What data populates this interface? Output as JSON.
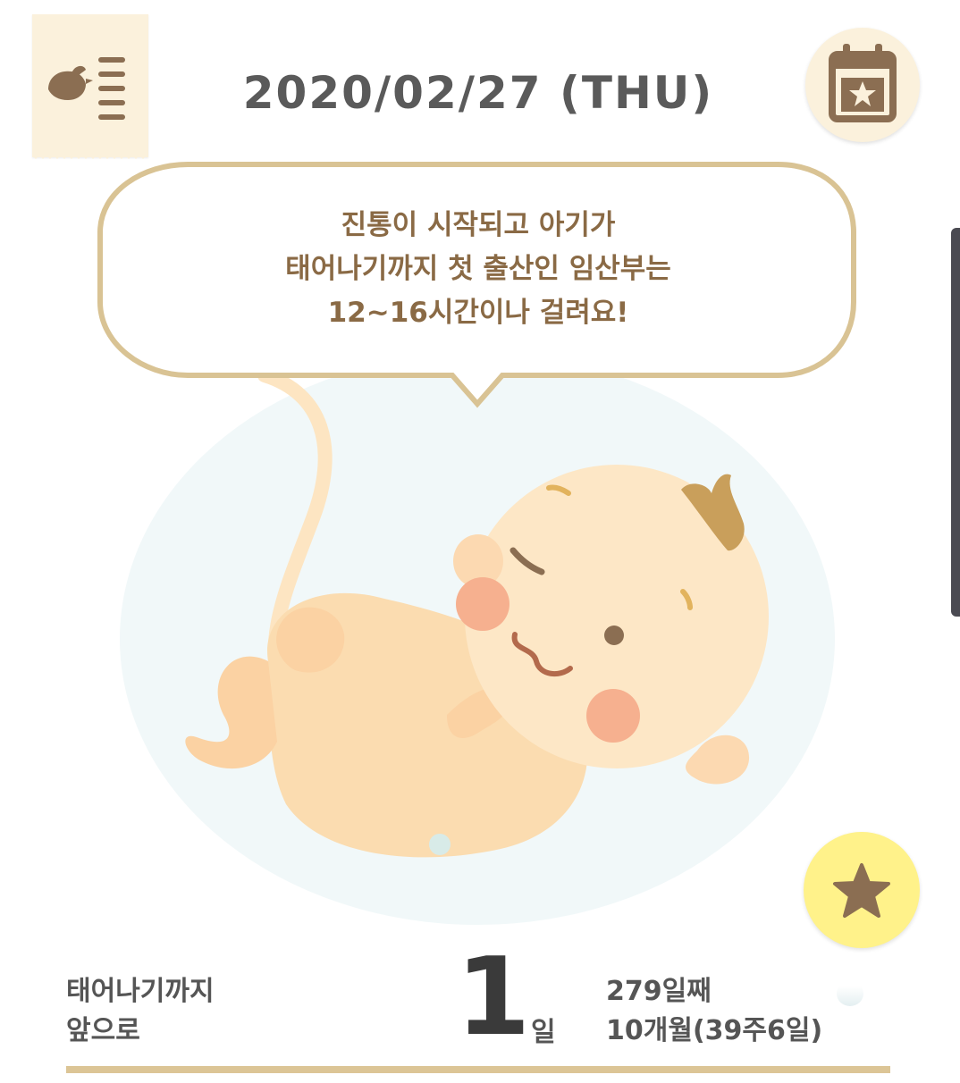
{
  "header": {
    "date": "2020/02/27 (THU)",
    "menu_icon": "bird-menu-icon",
    "calendar_icon": "calendar-star-icon"
  },
  "speech_bubble": {
    "lines": [
      "진통이 시작되고 아기가",
      "태어나기까지 첫 출산인 임산부는",
      "12~16시간이나 걸려요!"
    ]
  },
  "illustration": {
    "subject": "baby-in-womb"
  },
  "favorite": {
    "icon": "star-icon"
  },
  "countdown": {
    "label_line1": "태어나기까지",
    "label_line2": "앞으로",
    "days": "1",
    "unit": "일",
    "day_count": "279일째",
    "month_week": "10개월(39주6일)"
  },
  "colors": {
    "accent_beige": "#dcc596",
    "bubble_border": "#d9c394",
    "text_brown": "#8a6a45",
    "icon_brown": "#8b6e52",
    "favorite_yellow": "#fff28a",
    "panel_cream": "#fbf1dc"
  }
}
